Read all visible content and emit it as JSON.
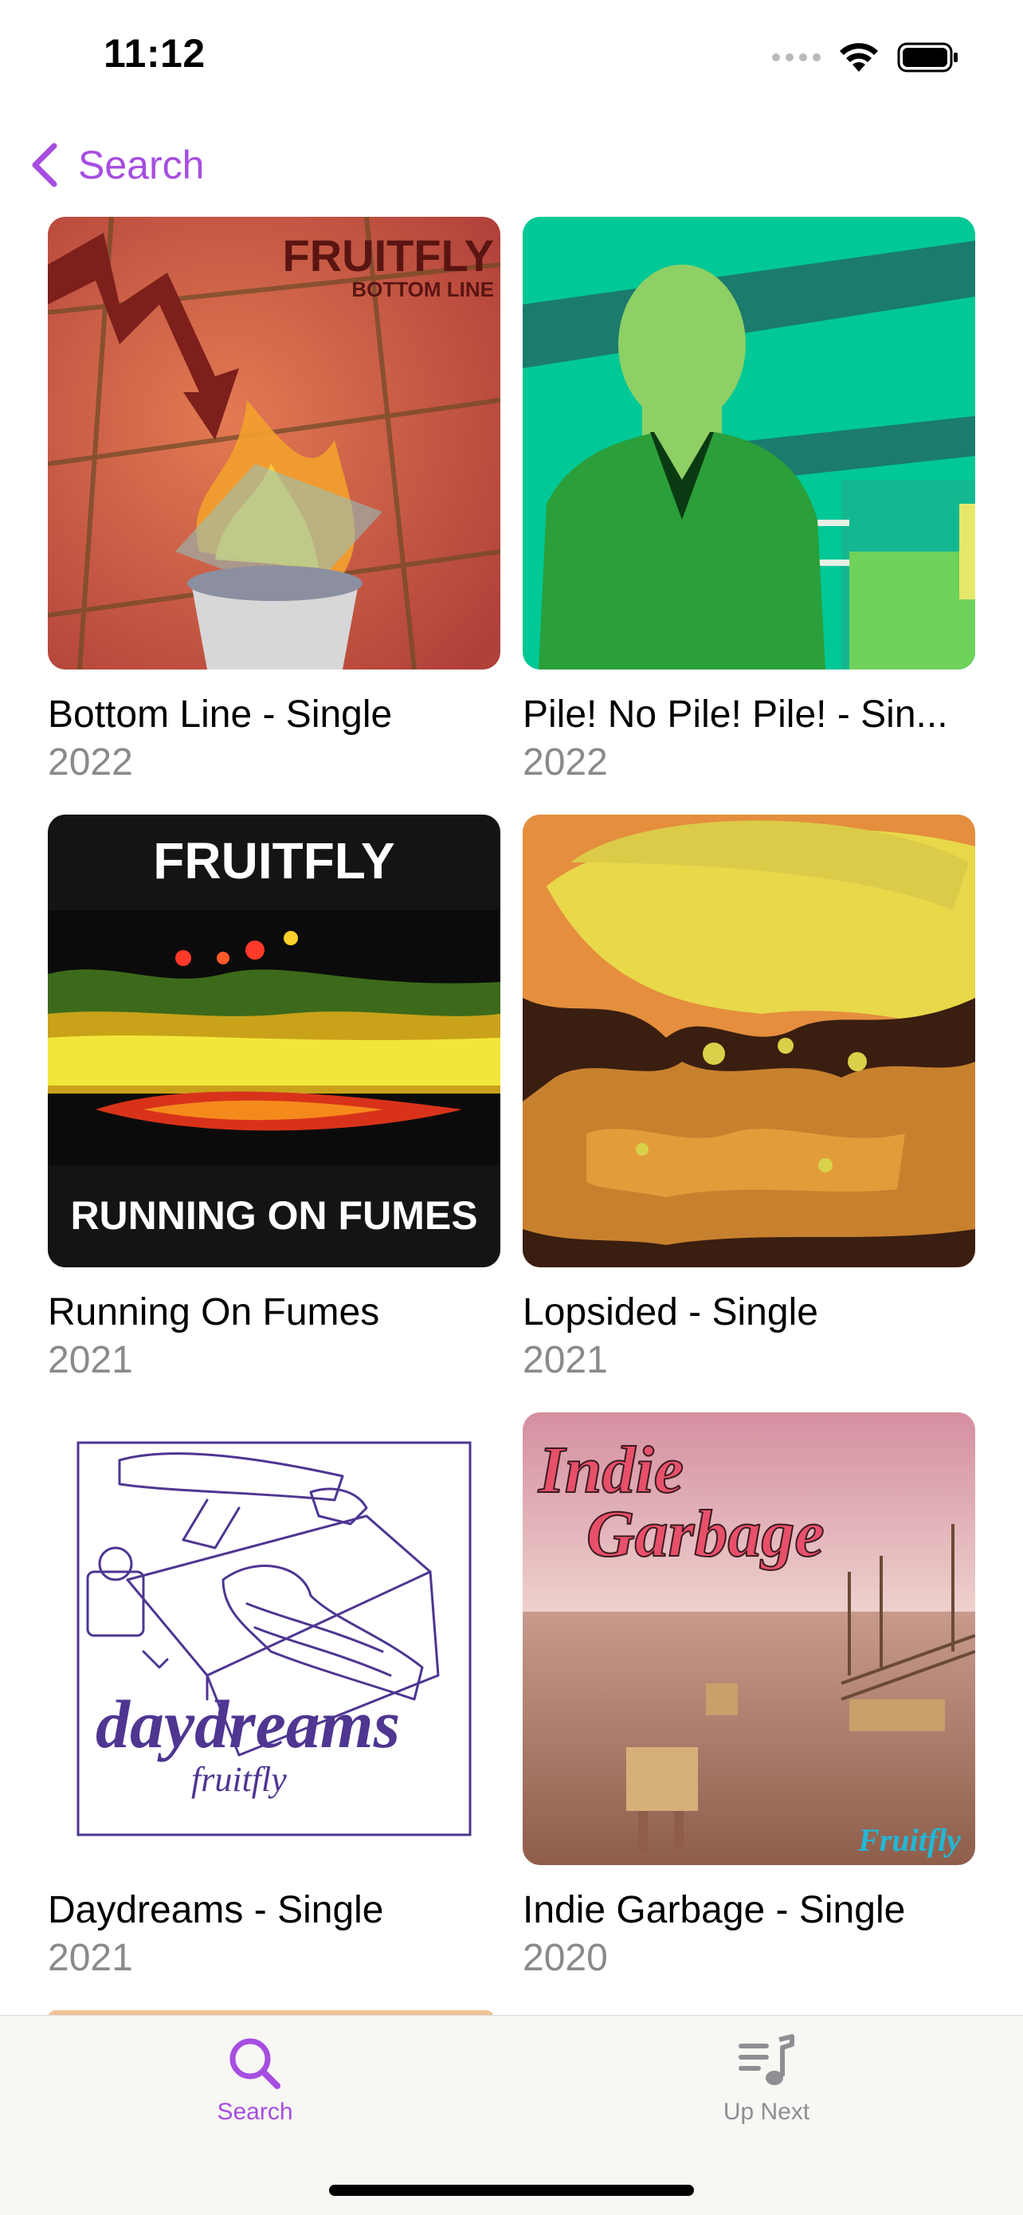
{
  "status_bar": {
    "time": "11:12"
  },
  "nav": {
    "back_label": "Search"
  },
  "albums": [
    {
      "title": "Bottom Line - Single",
      "year": "2022",
      "art_text": [
        "FRUITFLY",
        "BOTTOM LINE"
      ]
    },
    {
      "title": "Pile! No Pile! Pile! - Sin...",
      "year": "2022"
    },
    {
      "title": "Running On Fumes",
      "year": "2021",
      "art_text": [
        "FRUITFLY",
        "RUNNING ON FUMES"
      ]
    },
    {
      "title": "Lopsided - Single",
      "year": "2021"
    },
    {
      "title": "Daydreams - Single",
      "year": "2021",
      "art_text": [
        "daydreams",
        "fruitfly"
      ]
    },
    {
      "title": "Indie Garbage - Single",
      "year": "2020",
      "art_text": [
        "Indie",
        "Garbage",
        "Fruitfly"
      ]
    }
  ],
  "tabs": [
    {
      "label": "Search",
      "icon": "search-icon",
      "active": true
    },
    {
      "label": "Up Next",
      "icon": "music-list-icon",
      "active": false
    }
  ],
  "colors": {
    "accent": "#a64ee0",
    "inactive": "#8e8e93"
  }
}
